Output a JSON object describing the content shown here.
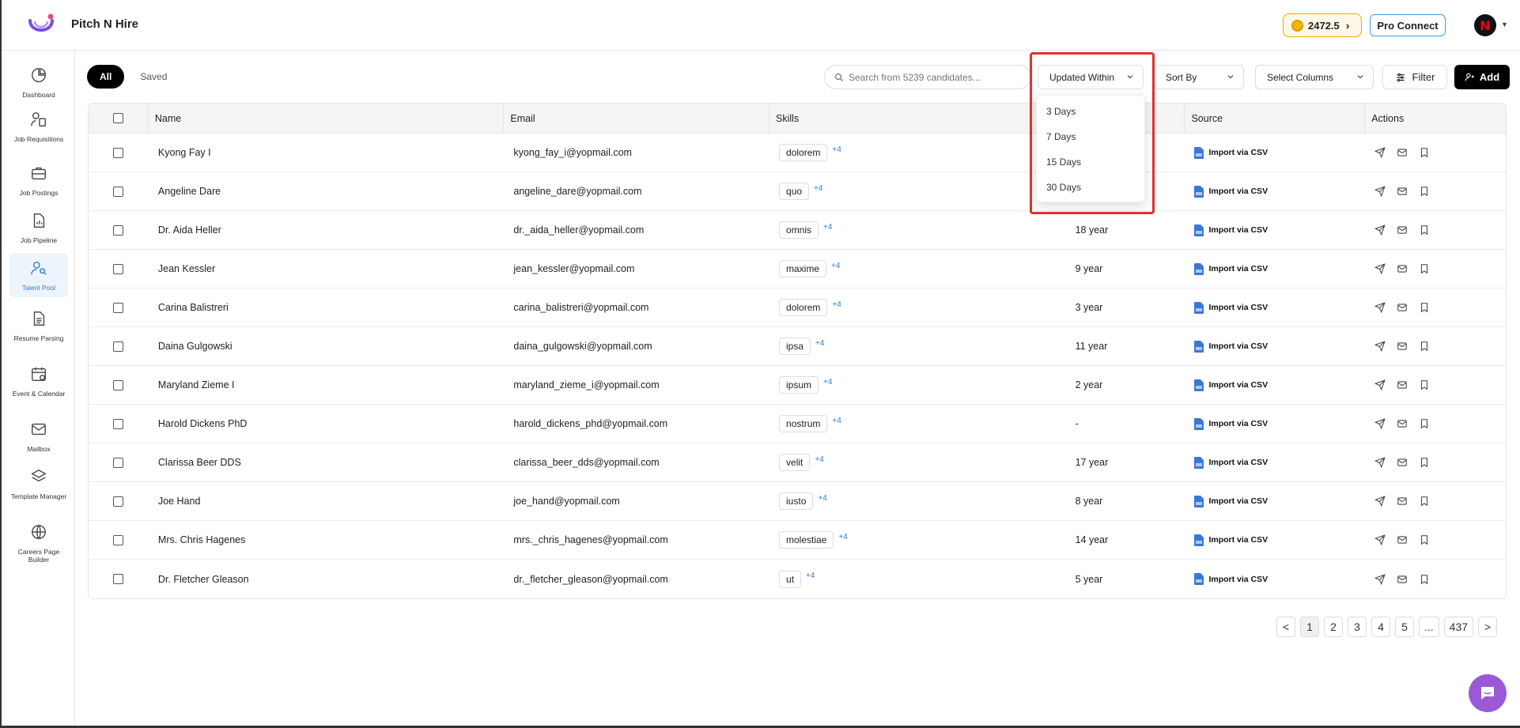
{
  "app": {
    "title": "Pitch N Hire"
  },
  "header": {
    "coins": "2472.5",
    "pro_connect": "Pro Connect"
  },
  "sidebar": {
    "items": [
      {
        "label": "Dashboard",
        "icon": "pie-chart-icon"
      },
      {
        "label": "Job Requisitions",
        "icon": "user-doc-icon"
      },
      {
        "label": "Job Postings",
        "icon": "briefcase-icon"
      },
      {
        "label": "Job Pipeline",
        "icon": "file-chart-icon"
      },
      {
        "label": "Talent Pool",
        "icon": "user-search-icon",
        "active": true
      },
      {
        "label": "Resume Parsing",
        "icon": "file-text-icon"
      },
      {
        "label": "Event & Calendar",
        "icon": "calendar-icon"
      },
      {
        "label": "Mailbox",
        "icon": "mail-icon"
      },
      {
        "label": "Template Manager",
        "icon": "layers-icon"
      },
      {
        "label": "Careers Page Builder",
        "icon": "globe-icon"
      }
    ]
  },
  "toolbar": {
    "tab_all": "All",
    "tab_saved": "Saved",
    "search_placeholder": "Search from 5239 candidates...",
    "updated_within": "Updated Within",
    "sort_by": "Sort By",
    "select_columns": "Select Columns",
    "filter": "Filter",
    "add": "Add"
  },
  "dropdown": {
    "options": [
      "3 Days",
      "7 Days",
      "15 Days",
      "30 Days"
    ]
  },
  "table": {
    "columns": [
      "Name",
      "Email",
      "Skills",
      "",
      "Source",
      "Actions"
    ],
    "rows": [
      {
        "name": "Kyong Fay I",
        "email": "kyong_fay_i@yopmail.com",
        "skill": "dolorem",
        "more": "+4",
        "exp": "",
        "source": "Import via CSV"
      },
      {
        "name": "Angeline Dare",
        "email": "angeline_dare@yopmail.com",
        "skill": "quo",
        "more": "+4",
        "exp": "",
        "source": "Import via CSV"
      },
      {
        "name": "Dr. Aida Heller",
        "email": "dr._aida_heller@yopmail.com",
        "skill": "omnis",
        "more": "+4",
        "exp": "18 year",
        "source": "Import via CSV"
      },
      {
        "name": "Jean Kessler",
        "email": "jean_kessler@yopmail.com",
        "skill": "maxime",
        "more": "+4",
        "exp": "9 year",
        "source": "Import via CSV"
      },
      {
        "name": "Carina Balistreri",
        "email": "carina_balistreri@yopmail.com",
        "skill": "dolorem",
        "more": "+4",
        "exp": "3 year",
        "source": "Import via CSV"
      },
      {
        "name": "Daina Gulgowski",
        "email": "daina_gulgowski@yopmail.com",
        "skill": "ipsa",
        "more": "+4",
        "exp": "11 year",
        "source": "Import via CSV"
      },
      {
        "name": "Maryland Zieme I",
        "email": "maryland_zieme_i@yopmail.com",
        "skill": "ipsum",
        "more": "+4",
        "exp": "2 year",
        "source": "Import via CSV"
      },
      {
        "name": "Harold Dickens PhD",
        "email": "harold_dickens_phd@yopmail.com",
        "skill": "nostrum",
        "more": "+4",
        "exp": "-",
        "source": "Import via CSV"
      },
      {
        "name": "Clarissa Beer DDS",
        "email": "clarissa_beer_dds@yopmail.com",
        "skill": "velit",
        "more": "+4",
        "exp": "17 year",
        "source": "Import via CSV"
      },
      {
        "name": "Joe Hand",
        "email": "joe_hand@yopmail.com",
        "skill": "iusto",
        "more": "+4",
        "exp": "8 year",
        "source": "Import via CSV"
      },
      {
        "name": "Mrs. Chris Hagenes",
        "email": "mrs._chris_hagenes@yopmail.com",
        "skill": "molestiae",
        "more": "+4",
        "exp": "14 year",
        "source": "Import via CSV"
      },
      {
        "name": "Dr. Fletcher Gleason",
        "email": "dr._fletcher_gleason@yopmail.com",
        "skill": "ut",
        "more": "+4",
        "exp": "5 year",
        "source": "Import via CSV"
      }
    ]
  },
  "pagination": {
    "prev": "<",
    "pages": [
      "1",
      "2",
      "3",
      "4",
      "5",
      "...",
      "437"
    ],
    "next": ">"
  },
  "colors": {
    "accent": "#2b7fd0",
    "highlight": "#e0312d",
    "chat": "#9b59d6"
  }
}
